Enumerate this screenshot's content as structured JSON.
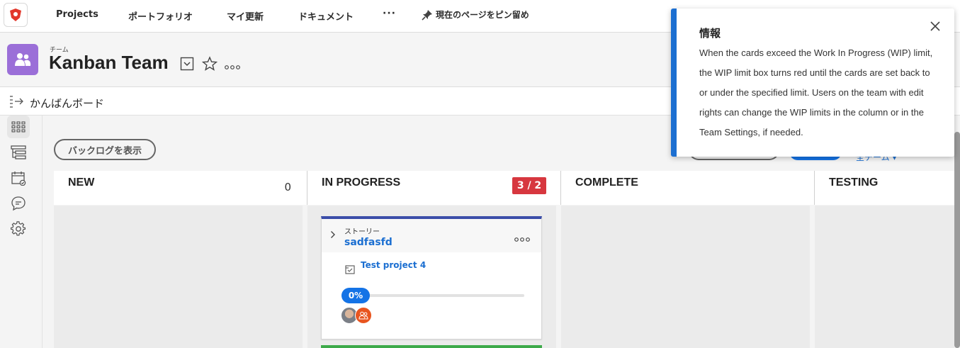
{
  "topnav": {
    "items": [
      "Projects",
      "ポートフォリオ",
      "マイ更新",
      "ドキュメント"
    ],
    "more": "···",
    "pin_label": "現在のページをピン留め"
  },
  "header": {
    "subtitle": "チーム",
    "title": "Kanban Team"
  },
  "boardbar": {
    "label": "かんばんボード"
  },
  "toolbar": {
    "backlog_button": "バックログを表示"
  },
  "columns": [
    {
      "title": "NEW",
      "count": "0"
    },
    {
      "title": "IN PROGRESS",
      "wip": "3 / 2"
    },
    {
      "title": "COMPLETE"
    },
    {
      "title": "TESTING"
    }
  ],
  "card": {
    "type": "ストーリー",
    "name": "sadfasfd",
    "project": "Test project 4",
    "progress_label": "0%",
    "progress": 0
  },
  "popover": {
    "title": "情報",
    "body": "When the cards exceed the Work In Progress (WIP) limit, the WIP limit box turns red until the cards are set back to or under the specified limit. Users on the team with edit rights can change the WIP limits in the column or in the Team Settings, if needed."
  },
  "colors": {
    "accent_blue": "#1473e6",
    "wip_red": "#d7373f",
    "team_purple": "#9b6fd8",
    "card_top_bar": "#3a4da8",
    "next_card_bar": "#3daa4a"
  }
}
